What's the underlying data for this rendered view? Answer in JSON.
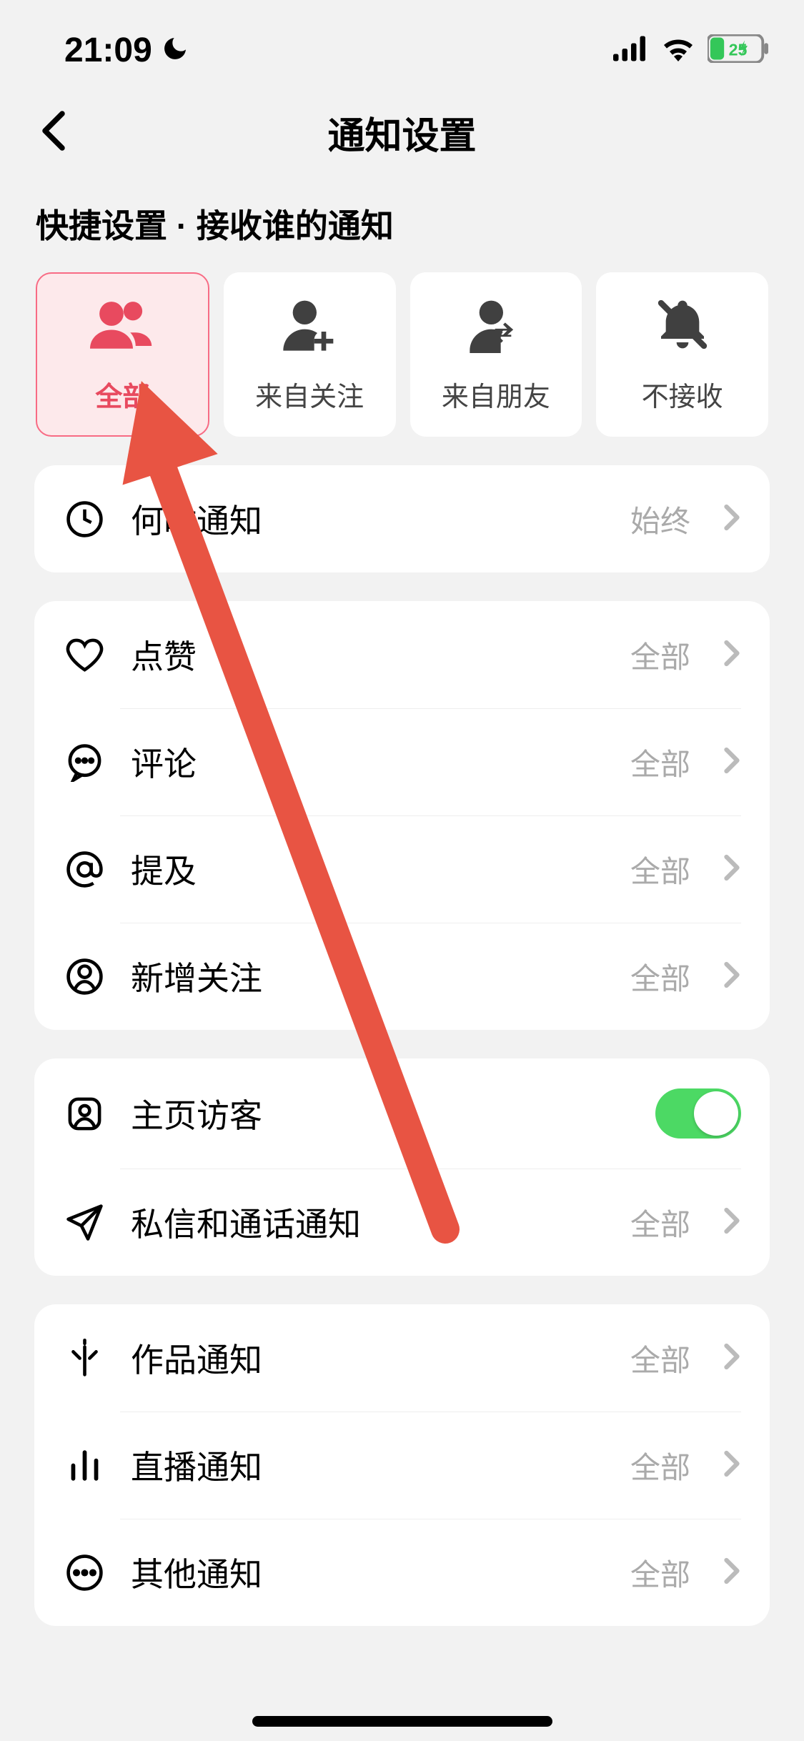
{
  "status": {
    "time": "21:09",
    "battery": "25"
  },
  "nav": {
    "title": "通知设置"
  },
  "section_header": "快捷设置 · 接收谁的通知",
  "quick": [
    {
      "label": "全部",
      "icon": "people"
    },
    {
      "label": "来自关注",
      "icon": "person-add"
    },
    {
      "label": "来自朋友",
      "icon": "person-exchange"
    },
    {
      "label": "不接收",
      "icon": "bell-off"
    }
  ],
  "groups": [
    {
      "rows": [
        {
          "icon": "clock",
          "label": "何时通知",
          "value": "始终",
          "type": "link"
        }
      ]
    },
    {
      "rows": [
        {
          "icon": "heart",
          "label": "点赞",
          "value": "全部",
          "type": "link"
        },
        {
          "icon": "comment",
          "label": "评论",
          "value": "全部",
          "type": "link"
        },
        {
          "icon": "mention",
          "label": "提及",
          "value": "全部",
          "type": "link"
        },
        {
          "icon": "follower",
          "label": "新增关注",
          "value": "全部",
          "type": "link"
        }
      ]
    },
    {
      "rows": [
        {
          "icon": "visitor",
          "label": "主页访客",
          "type": "toggle"
        },
        {
          "icon": "send",
          "label": "私信和通话通知",
          "value": "全部",
          "type": "link"
        }
      ]
    },
    {
      "rows": [
        {
          "icon": "sparkle",
          "label": "作品通知",
          "value": "全部",
          "type": "link"
        },
        {
          "icon": "bars",
          "label": "直播通知",
          "value": "全部",
          "type": "link"
        },
        {
          "icon": "more",
          "label": "其他通知",
          "value": "全部",
          "type": "link"
        }
      ]
    }
  ]
}
